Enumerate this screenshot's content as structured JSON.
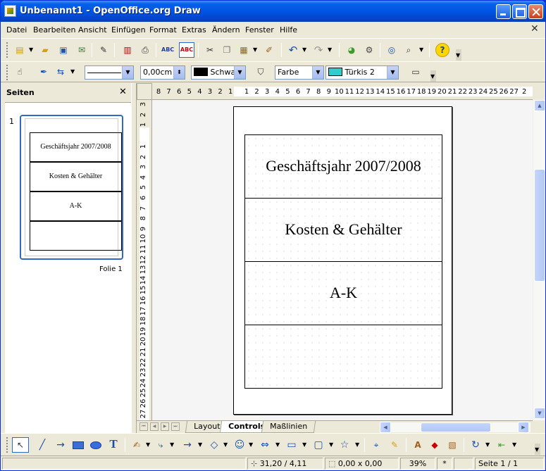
{
  "window": {
    "title": "Unbenannt1 - OpenOffice.org Draw"
  },
  "menu": {
    "items": [
      "Datei",
      "Bearbeiten",
      "Ansicht",
      "Einfügen",
      "Format",
      "Extras",
      "Ändern",
      "Fenster",
      "Hilfe"
    ],
    "close_symbol": "✕"
  },
  "toolbar2": {
    "line_width": "0,00cm",
    "line_color": "Schwarz",
    "area_style": "Farbe",
    "area_color": "Türkis 2",
    "line_color_hex": "#000000",
    "area_color_hex": "#33cccc"
  },
  "sidebar": {
    "title": "Seiten",
    "close_symbol": "✕",
    "slide_number": "1",
    "slide_label": "Folie 1",
    "thumb_cells": [
      "Geschäftsjahr 2007/2008",
      "Kosten & Gehälter",
      "A-K",
      ""
    ]
  },
  "ruler": {
    "h_left": [
      "8",
      "7",
      "6",
      "5",
      "4",
      "3",
      "2",
      "1"
    ],
    "h_right": [
      "1",
      "2",
      "3",
      "4",
      "5",
      "6",
      "7",
      "8",
      "9",
      "10",
      "11",
      "12",
      "13",
      "14",
      "15",
      "16",
      "17",
      "18",
      "19",
      "20",
      "21",
      "22",
      "23",
      "24",
      "25",
      "26",
      "27",
      "2"
    ],
    "v_top": [
      "3",
      "2",
      "1"
    ],
    "v_main": [
      "1",
      "2",
      "3",
      "4",
      "5",
      "6",
      "7",
      "8",
      "9",
      "10",
      "11",
      "12",
      "13",
      "14",
      "15",
      "16",
      "17",
      "18",
      "19",
      "20",
      "21",
      "22",
      "23",
      "24",
      "25",
      "26",
      "27"
    ]
  },
  "page": {
    "cells": [
      "Geschäftsjahr 2007/2008",
      "Kosten & Gehälter",
      "A-K",
      ""
    ]
  },
  "tabs": {
    "layout": "Layout",
    "controls": "Controls",
    "dimensions": "Maßlinien"
  },
  "status": {
    "position": "31,20 / 4,11",
    "size": "0,00 x 0,00",
    "zoom": "39%",
    "modified": "*",
    "page": "Seite 1 / 1"
  }
}
